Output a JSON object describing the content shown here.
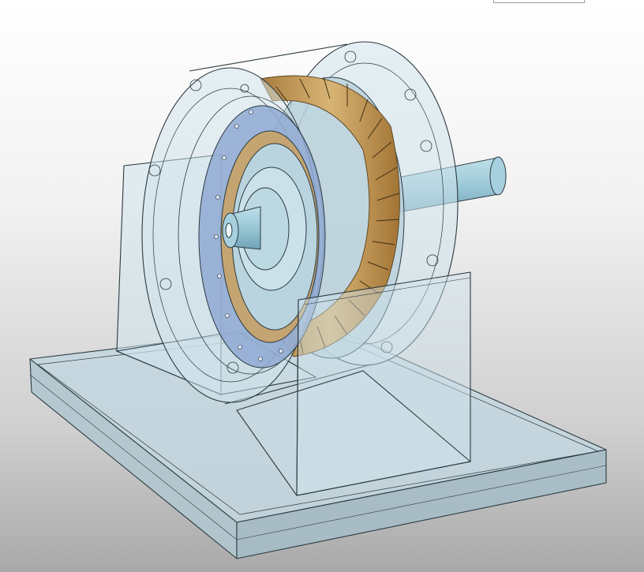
{
  "viewport": {
    "background_top": "#ffffff",
    "background_bottom": "#a9a9a9"
  },
  "colors": {
    "glass_fill": "#cfe3ec",
    "glass_edge": "#2b3a40",
    "stator_teeth": "#c9a367",
    "stator_teeth_dark": "#8f6a34",
    "shaft": "#9ac7d6",
    "hub_plate": "#8fa9d2"
  },
  "model": {
    "parts": [
      "base-plate",
      "rear-support",
      "front-support",
      "rear-housing-disc",
      "front-housing-disc",
      "stator-ring",
      "stator-teeth",
      "rotor-hub",
      "shaft"
    ],
    "stator_teeth_count": 24
  }
}
